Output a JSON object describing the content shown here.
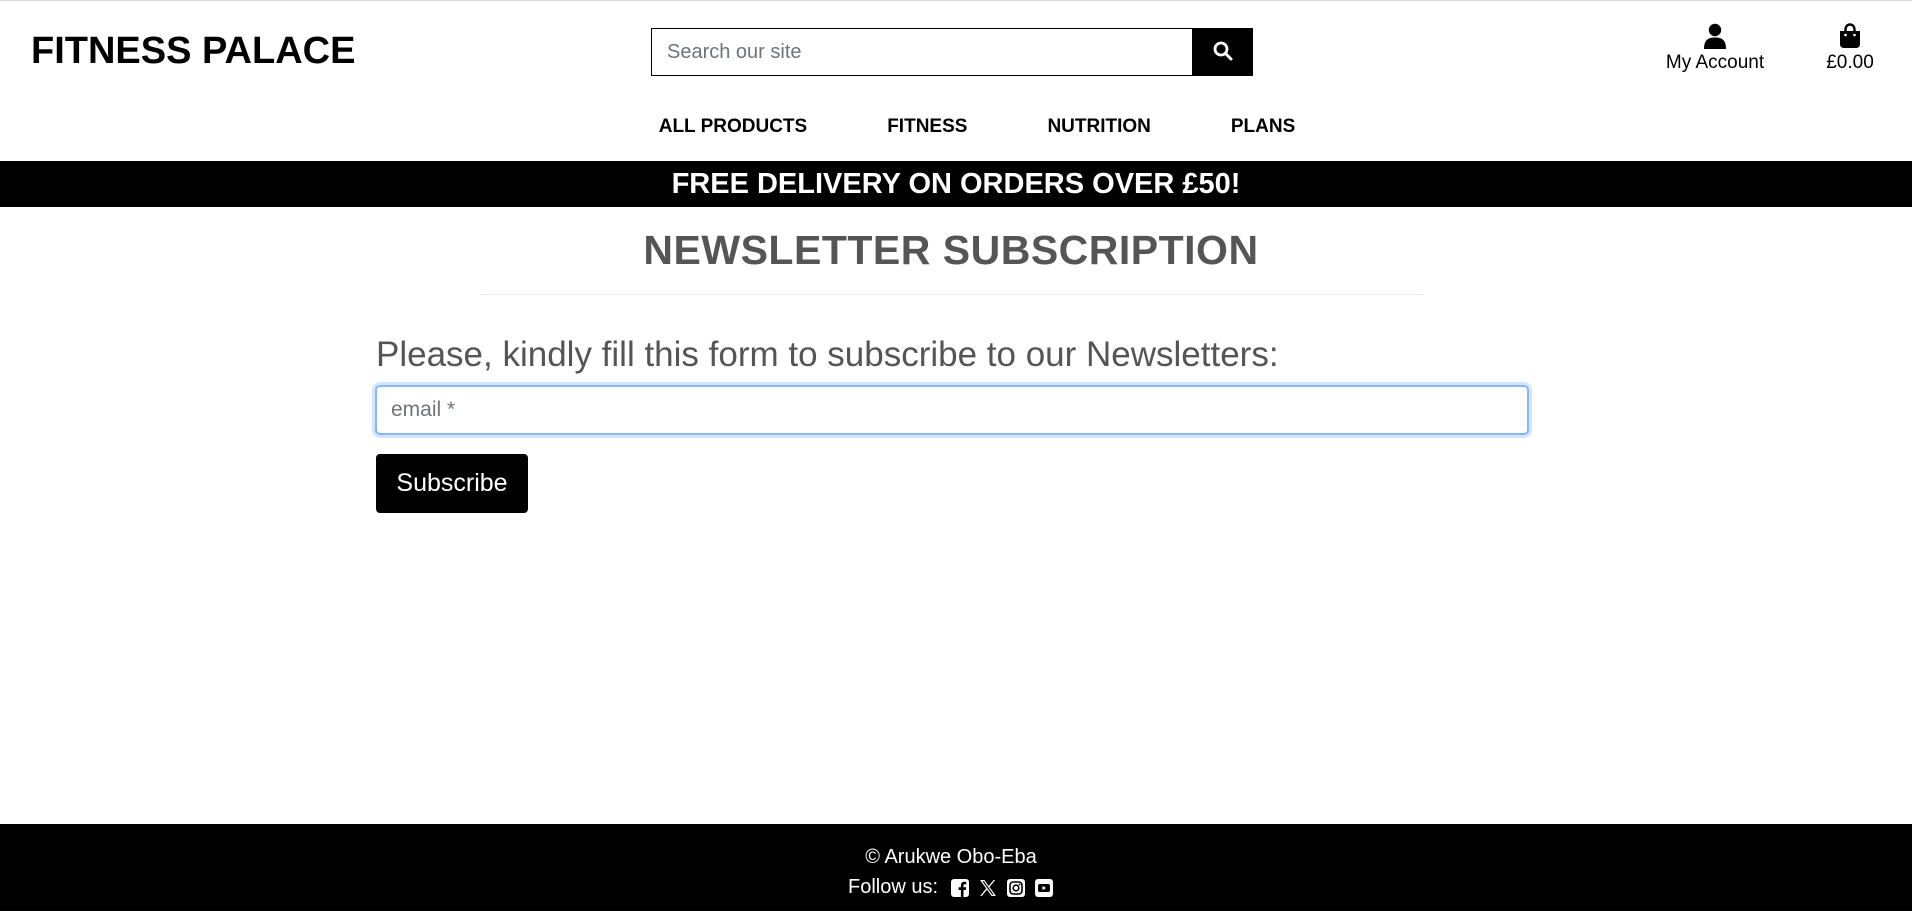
{
  "header": {
    "brand": "FITNESS PALACE",
    "search": {
      "placeholder": "Search our site",
      "button_icon": "search-icon"
    },
    "account": {
      "label": "My Account",
      "icon": "user-icon"
    },
    "bag": {
      "total": "£0.00",
      "icon": "shopping-bag-icon"
    }
  },
  "nav": {
    "items": [
      {
        "label": "ALL PRODUCTS"
      },
      {
        "label": "FITNESS"
      },
      {
        "label": "NUTRITION"
      },
      {
        "label": "PLANS"
      }
    ]
  },
  "banner": {
    "text": "FREE DELIVERY ON ORDERS OVER £50!"
  },
  "main": {
    "title": "NEWSLETTER SUBSCRIPTION",
    "intro": "Please, kindly fill this form to subscribe to our Newsletters:",
    "email_placeholder": "email *",
    "email_value": "",
    "subscribe_label": "Subscribe"
  },
  "footer": {
    "copyright": "© Arukwe Obo-Eba",
    "follow_label": "Follow us:",
    "social": [
      {
        "icon": "facebook-icon"
      },
      {
        "icon": "x-twitter-icon"
      },
      {
        "icon": "instagram-icon"
      },
      {
        "icon": "youtube-icon"
      }
    ]
  },
  "colors": {
    "primary": "#000000",
    "background": "#ffffff",
    "heading_text": "#555555",
    "focus_ring": "#86b7fe"
  }
}
